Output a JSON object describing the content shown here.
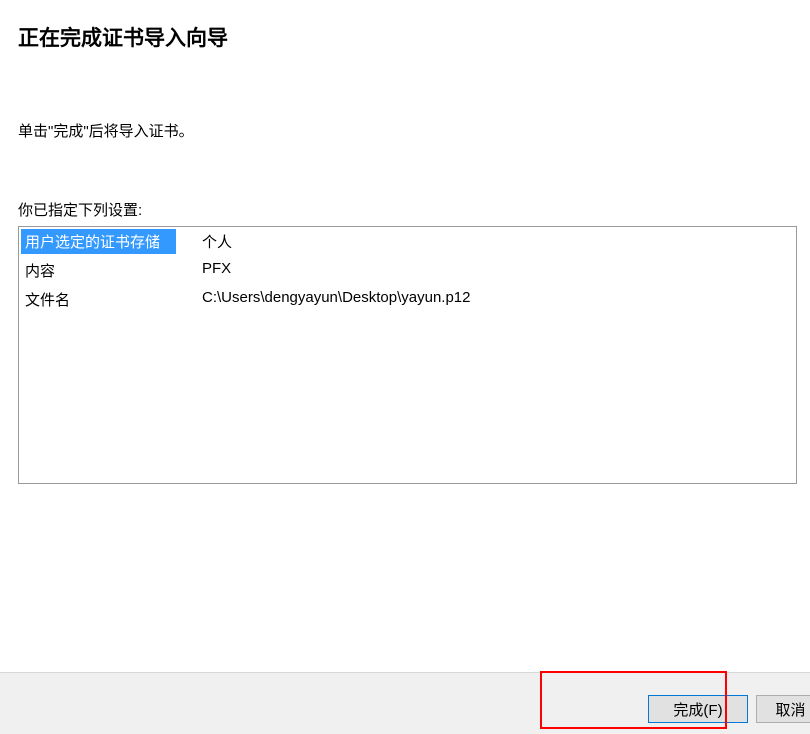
{
  "wizard": {
    "title": "正在完成证书导入向导",
    "instruction": "单击\"完成\"后将导入证书。",
    "settings_label": "你已指定下列设置:",
    "rows": [
      {
        "key": "用户选定的证书存储",
        "value": "个人",
        "highlighted": true
      },
      {
        "key": "内容",
        "value": "PFX",
        "highlighted": false
      },
      {
        "key": "文件名",
        "value": "C:\\Users\\dengyayun\\Desktop\\yayun.p12",
        "highlighted": false
      }
    ]
  },
  "buttons": {
    "finish": "完成(F)",
    "cancel": "取消"
  }
}
